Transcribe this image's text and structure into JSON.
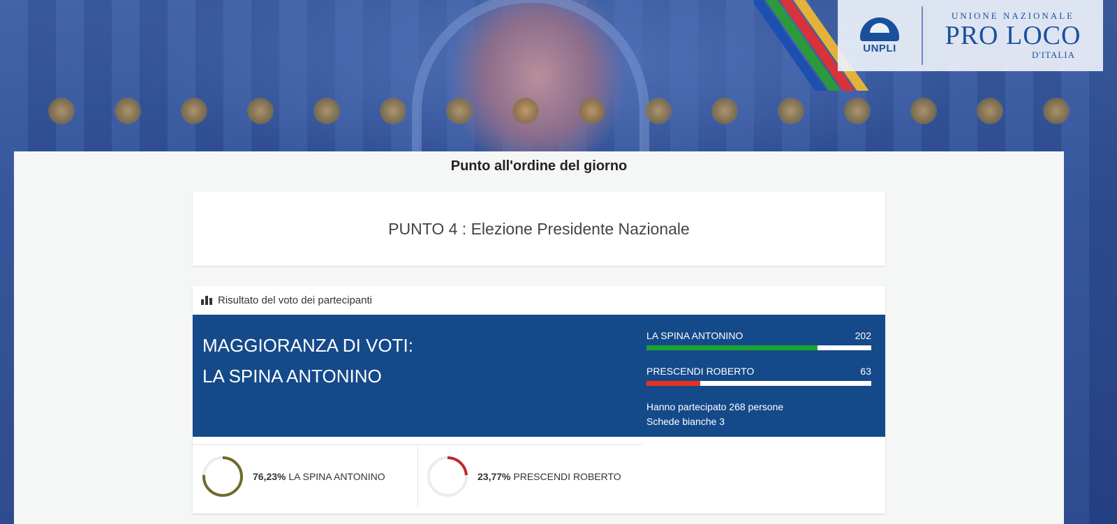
{
  "header": {
    "unpli_logo_text": "UNPLI",
    "proloco_line1": "UNIONE NAZIONALE",
    "proloco_line2": "PRO LOCO",
    "proloco_line3": "D'ITALIA"
  },
  "title": "Punto all'ordine del giorno",
  "agenda_item": "PUNTO 4 : Elezione Presidente Nazionale",
  "results": {
    "header": "Risultato del voto dei partecipanti",
    "majority_label": "MAGGIORANZA DI VOTI:",
    "majority_winner": "LA SPINA ANTONINO",
    "candidates": [
      {
        "name": "LA SPINA ANTONINO",
        "votes": "202",
        "share": 0.7623,
        "bar_color": "#1aa52e",
        "ring_color": "#6e6a2c",
        "percent": "76,23%"
      },
      {
        "name": "PRESCENDI ROBERTO",
        "votes": "63",
        "share": 0.2377,
        "bar_color": "#e8321e",
        "ring_color": "#c0262c",
        "percent": "23,77%"
      }
    ],
    "participants": "Hanno partecipato 268 persone",
    "blank_ballots": "Schede bianche 3"
  },
  "colors": {
    "result_bg": "#154a8a"
  }
}
